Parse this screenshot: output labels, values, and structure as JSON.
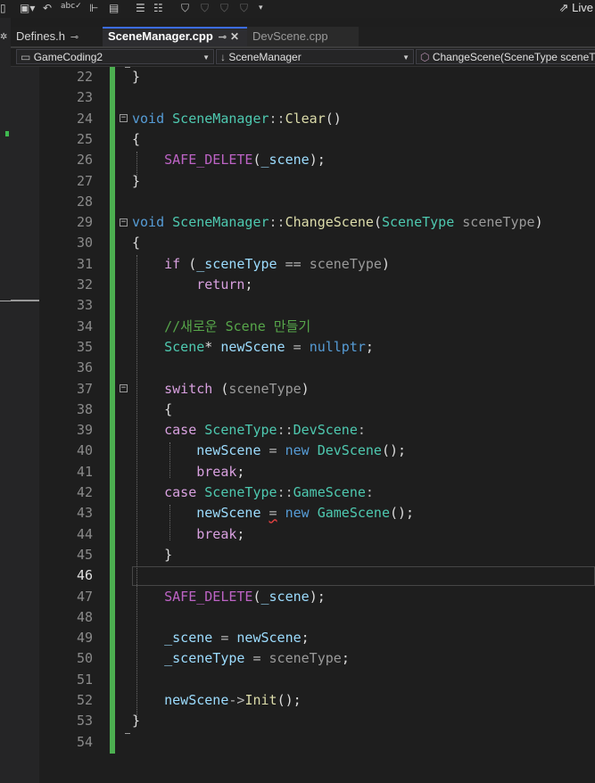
{
  "toolbar": {
    "live_label": "Live"
  },
  "tabs": [
    {
      "label": "Defines.h",
      "pin": "⊸",
      "close": "✕"
    },
    {
      "label": "SceneManager.cpp",
      "pin": "⊸",
      "close": "✕"
    },
    {
      "label": "DevScene.cpp"
    }
  ],
  "nav": {
    "project": "GameCoding2",
    "scope": "SceneManager",
    "member": "ChangeScene(SceneType sceneType)"
  },
  "editor": {
    "current_line": 46,
    "lines": [
      {
        "n": "22",
        "text": "}"
      },
      {
        "n": "23",
        "text": ""
      },
      {
        "n": "24",
        "text": "void SceneManager::Clear()"
      },
      {
        "n": "25",
        "text": "{"
      },
      {
        "n": "26",
        "text": "    SAFE_DELETE(_scene);"
      },
      {
        "n": "27",
        "text": "}"
      },
      {
        "n": "28",
        "text": ""
      },
      {
        "n": "29",
        "text": "void SceneManager::ChangeScene(SceneType sceneType)"
      },
      {
        "n": "30",
        "text": "{"
      },
      {
        "n": "31",
        "text": "    if (_sceneType == sceneType)"
      },
      {
        "n": "32",
        "text": "        return;"
      },
      {
        "n": "33",
        "text": ""
      },
      {
        "n": "34",
        "text": "    //새로운 Scene 만들기"
      },
      {
        "n": "35",
        "text": "    Scene* newScene = nullptr;"
      },
      {
        "n": "36",
        "text": ""
      },
      {
        "n": "37",
        "text": "    switch (sceneType)"
      },
      {
        "n": "38",
        "text": "    {"
      },
      {
        "n": "39",
        "text": "    case SceneType::DevScene:"
      },
      {
        "n": "40",
        "text": "        newScene = new DevScene();"
      },
      {
        "n": "41",
        "text": "        break;"
      },
      {
        "n": "42",
        "text": "    case SceneType::GameScene:"
      },
      {
        "n": "43",
        "text": "        newScene = new GameScene();"
      },
      {
        "n": "44",
        "text": "        break;"
      },
      {
        "n": "45",
        "text": "    }"
      },
      {
        "n": "46",
        "text": ""
      },
      {
        "n": "47",
        "text": "    SAFE_DELETE(_scene);"
      },
      {
        "n": "48",
        "text": ""
      },
      {
        "n": "49",
        "text": "    _scene = newScene;"
      },
      {
        "n": "50",
        "text": "    _sceneType = sceneType;"
      },
      {
        "n": "51",
        "text": ""
      },
      {
        "n": "52",
        "text": "    newScene->Init();"
      },
      {
        "n": "53",
        "text": "}"
      },
      {
        "n": "54",
        "text": ""
      }
    ]
  },
  "colors": {
    "keyword": "#569cd6",
    "type": "#4ec9b0",
    "function": "#dcdcaa",
    "variable": "#9cdcfe",
    "parameter": "#9a9a9a",
    "comment": "#57a64a",
    "control_keyword": "#d8a0df",
    "macro": "#bd63c5",
    "change_bar": "#4caf50",
    "active_tab_accent": "#3c6df0"
  }
}
